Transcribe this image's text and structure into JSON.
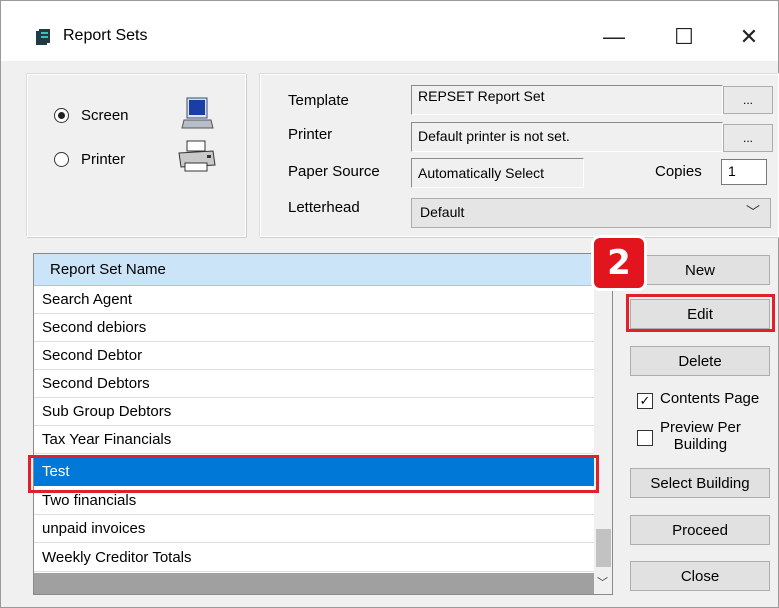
{
  "window": {
    "title": "Report Sets",
    "minimize": "—",
    "maximize": "☐",
    "close": "✕"
  },
  "output": {
    "screen_label": "Screen",
    "printer_label": "Printer",
    "selected": "Screen"
  },
  "template": {
    "template_label": "Template",
    "template_value": "REPSET Report Set",
    "printer_label": "Printer",
    "printer_value": "Default printer is not set.",
    "paper_label": "Paper Source",
    "paper_value": "Automatically Select",
    "copies_label": "Copies",
    "copies_value": "1",
    "letterhead_label": "Letterhead",
    "letterhead_value": "Default",
    "browse": "..."
  },
  "list": {
    "header": "Report Set Name",
    "rows": [
      "Search Agent",
      "Second debiors",
      "Second Debtor",
      "Second Debtors",
      "Sub Group Debtors",
      "Tax Year Financials",
      "Test",
      "Two financials",
      "unpaid invoices",
      "Weekly Creditor Totals"
    ],
    "selected": "Test"
  },
  "actions": {
    "new": "New",
    "edit": "Edit",
    "delete": "Delete",
    "contents_page": "Contents Page",
    "contents_page_checked": true,
    "preview_per_building_1": "Preview Per",
    "preview_per_building_2": "Building",
    "preview_per_building_checked": false,
    "select_building": "Select Building",
    "proceed": "Proceed",
    "close": "Close"
  },
  "annotation": {
    "step": "2",
    "color": "#e2141e"
  }
}
